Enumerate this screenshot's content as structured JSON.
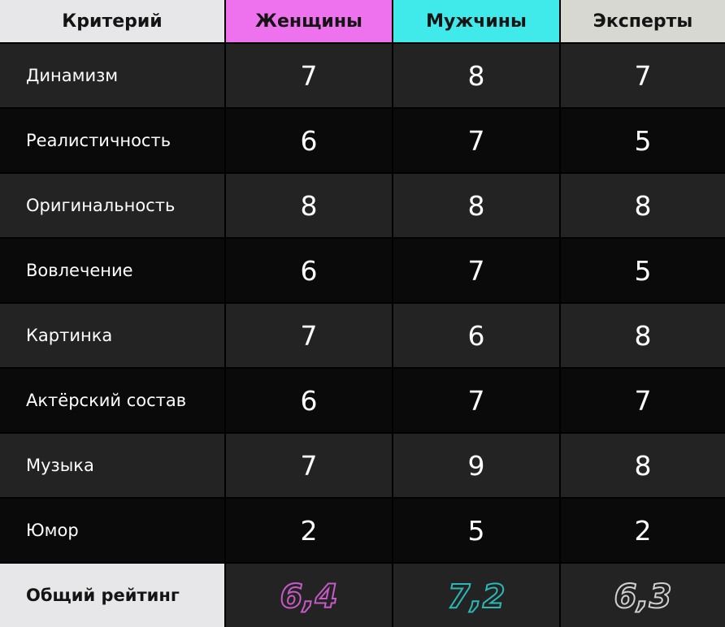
{
  "table": {
    "header": {
      "criterion": "Критерий",
      "columns": [
        {
          "label": "Женщины",
          "color": "#ee72ee"
        },
        {
          "label": "Мужчины",
          "color": "#40eaea"
        },
        {
          "label": "Эксперты",
          "color": "#d8d8d2"
        }
      ]
    },
    "footer_label": "Общий рейтинг",
    "overall": [
      "6,4",
      "7,2",
      "6,3"
    ],
    "rating_colors": [
      "#c65bc6",
      "#2cb8b6",
      "#cfcfcf"
    ]
  },
  "chart_data": {
    "type": "table",
    "columns": [
      "Критерий",
      "Женщины",
      "Мужчины",
      "Эксперты"
    ],
    "categories": [
      "Динамизм",
      "Реалистичность",
      "Оригинальность",
      "Вовлечение",
      "Картинка",
      "Актёрский состав",
      "Музыка",
      "Юмор"
    ],
    "series": [
      {
        "name": "Женщины",
        "values": [
          7,
          6,
          8,
          6,
          7,
          6,
          7,
          2
        ]
      },
      {
        "name": "Мужчины",
        "values": [
          8,
          7,
          8,
          7,
          6,
          7,
          9,
          5
        ]
      },
      {
        "name": "Эксперты",
        "values": [
          7,
          5,
          8,
          5,
          8,
          7,
          8,
          2
        ]
      }
    ],
    "totals": [
      "6,4",
      "7,2",
      "6,3"
    ]
  }
}
